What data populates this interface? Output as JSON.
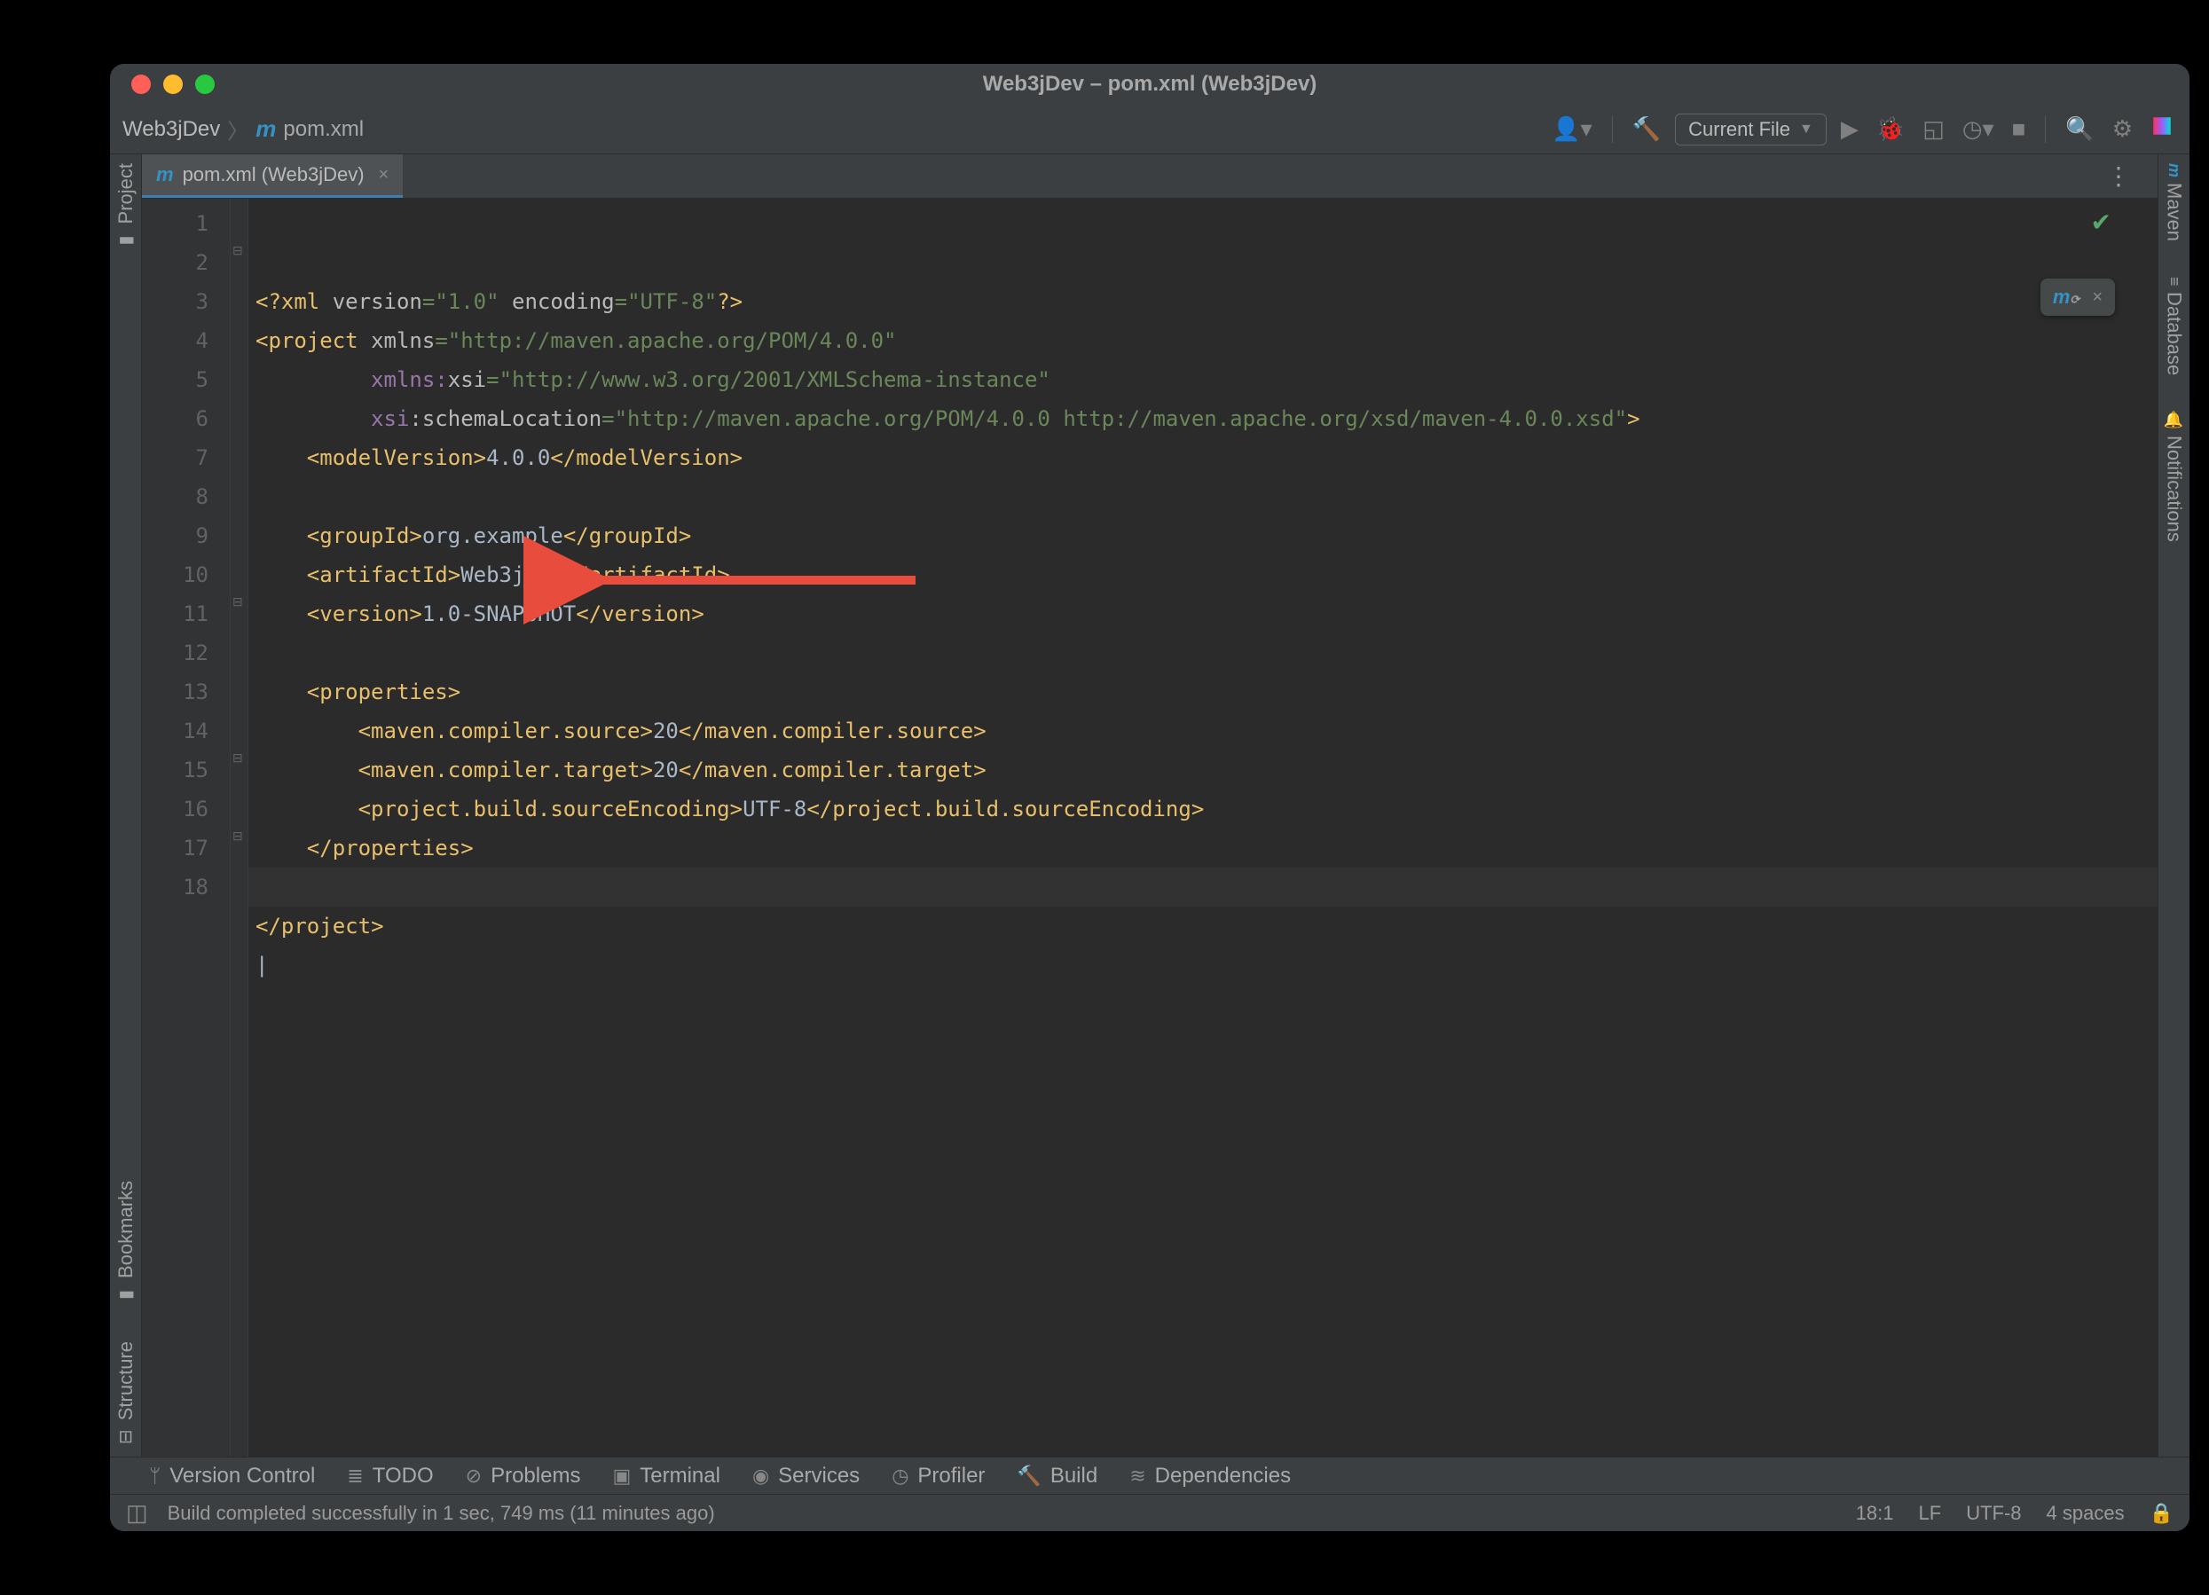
{
  "titlebar": {
    "title": "Web3jDev – pom.xml (Web3jDev)"
  },
  "breadcrumb": {
    "project": "Web3jDev",
    "file": "pom.xml"
  },
  "toolbar": {
    "run_config": "Current File"
  },
  "tabs": [
    {
      "label": "pom.xml (Web3jDev)"
    }
  ],
  "gutter_lines": [
    "1",
    "2",
    "3",
    "4",
    "5",
    "6",
    "7",
    "8",
    "9",
    "10",
    "11",
    "12",
    "13",
    "14",
    "15",
    "16",
    "17",
    "18"
  ],
  "code": {
    "l1": {
      "pre": "<?",
      "tag": "xml",
      "a1": "version",
      "v1": "\"1.0\"",
      "a2": "encoding",
      "v2": "\"UTF-8\"",
      "post": "?>"
    },
    "l2": {
      "tag": "project",
      "a": "xmlns",
      "v": "\"http://maven.apache.org/POM/4.0.0\""
    },
    "l3": {
      "ns": "xmlns:",
      "a": "xsi",
      "v": "\"http://www.w3.org/2001/XMLSchema-instance\""
    },
    "l4": {
      "ns": "xsi",
      "a": ":schemaLocation",
      "v": "\"http://maven.apache.org/POM/4.0.0 http://maven.apache.org/xsd/maven-4.0.0.xsd\""
    },
    "l5": {
      "o": "modelVersion",
      "t": "4.0.0",
      "c": "modelVersion"
    },
    "l7": {
      "o": "groupId",
      "t": "org.example",
      "c": "groupId"
    },
    "l8": {
      "o": "artifactId",
      "t": "Web3jDev",
      "c": "artifactId"
    },
    "l9": {
      "o": "version",
      "t": "1.0-SNAPSHOT",
      "c": "version"
    },
    "l11": {
      "o": "properties"
    },
    "l12": {
      "o": "maven.compiler.source",
      "t": "20",
      "c": "maven.compiler.source"
    },
    "l13": {
      "o": "maven.compiler.target",
      "t": "20",
      "c": "maven.compiler.target"
    },
    "l14": {
      "o": "project.build.sourceEncoding",
      "t": "UTF-8",
      "c": "project.build.sourceEncoding"
    },
    "l15": {
      "c": "properties"
    },
    "l17": {
      "c": "project"
    }
  },
  "left_rail": {
    "project": "Project",
    "bookmarks": "Bookmarks",
    "structure": "Structure"
  },
  "right_rail": {
    "maven": "Maven",
    "database": "Database",
    "notifications": "Notifications"
  },
  "bottom_tools": {
    "vcs": "Version Control",
    "todo": "TODO",
    "problems": "Problems",
    "terminal": "Terminal",
    "services": "Services",
    "profiler": "Profiler",
    "build": "Build",
    "dependencies": "Dependencies"
  },
  "status": {
    "message": "Build completed successfully in 1 sec, 749 ms (11 minutes ago)",
    "pos": "18:1",
    "line_sep": "LF",
    "encoding": "UTF-8",
    "indent": "4 spaces"
  }
}
